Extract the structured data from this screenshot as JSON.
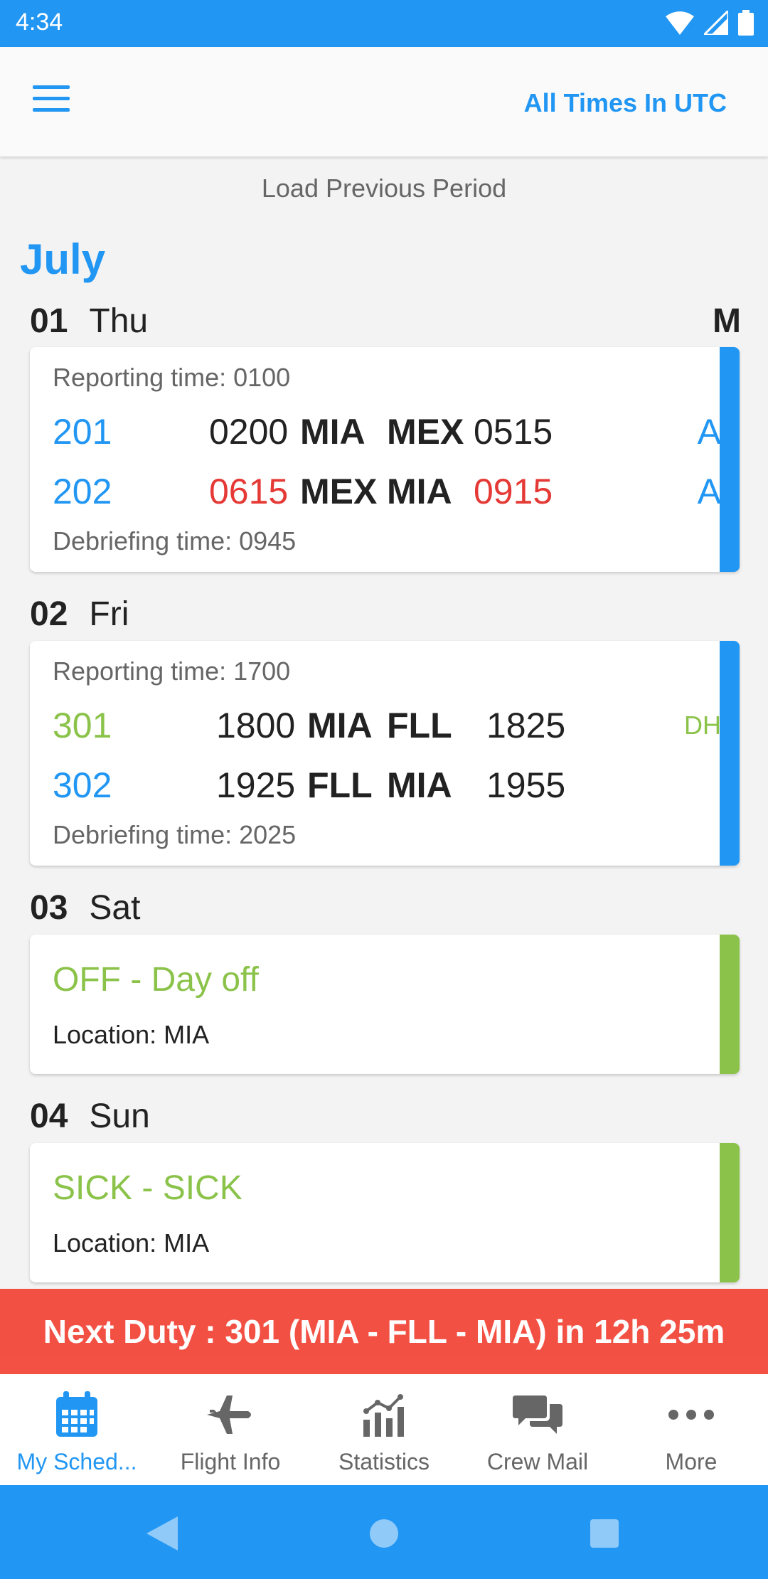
{
  "status_bar": {
    "time": "4:34"
  },
  "app_bar": {
    "times_label": "All Times In UTC"
  },
  "load_previous": "Load Previous Period",
  "month": "July",
  "days": [
    {
      "num": "01",
      "name": "Thu",
      "flag": "M",
      "reporting": "Reporting time: 0100",
      "debriefing": "Debriefing time: 0945",
      "legs": [
        {
          "flight": "201",
          "dep_time": "0200",
          "from": "MIA",
          "to": "MEX",
          "arr_time": "0515",
          "status": "A"
        },
        {
          "flight": "202",
          "dep_time": "0615",
          "from": "MEX",
          "to": "MIA",
          "arr_time": "0915",
          "status": "A"
        }
      ]
    },
    {
      "num": "02",
      "name": "Fri",
      "reporting": "Reporting time: 1700",
      "debriefing": "Debriefing time: 2025",
      "legs": [
        {
          "flight": "301",
          "dep_time": "1800",
          "from": "MIA",
          "to": "FLL",
          "arr_time": "1825",
          "status": "DH"
        },
        {
          "flight": "302",
          "dep_time": "1925",
          "from": "FLL",
          "to": "MIA",
          "arr_time": "1955",
          "status": ""
        }
      ]
    },
    {
      "num": "03",
      "name": "Sat",
      "title": "OFF - Day off",
      "location": "Location: MIA"
    },
    {
      "num": "04",
      "name": "Sun",
      "title": "SICK - SICK",
      "location": "Location: MIA"
    }
  ],
  "next_duty": "Next Duty : 301 (MIA  - FLL - MIA) in 12h 25m",
  "bottom_nav": [
    {
      "label": "My Sched...",
      "icon": "calendar-icon",
      "active": true
    },
    {
      "label": "Flight Info",
      "icon": "airplane-icon"
    },
    {
      "label": "Statistics",
      "icon": "chart-icon"
    },
    {
      "label": "Crew Mail",
      "icon": "chat-icon"
    },
    {
      "label": "More",
      "icon": "more-icon"
    }
  ],
  "colors": {
    "primary": "#2196F3",
    "green": "#8BC34A",
    "red": "#F44336",
    "delay_red": "#E53935"
  }
}
